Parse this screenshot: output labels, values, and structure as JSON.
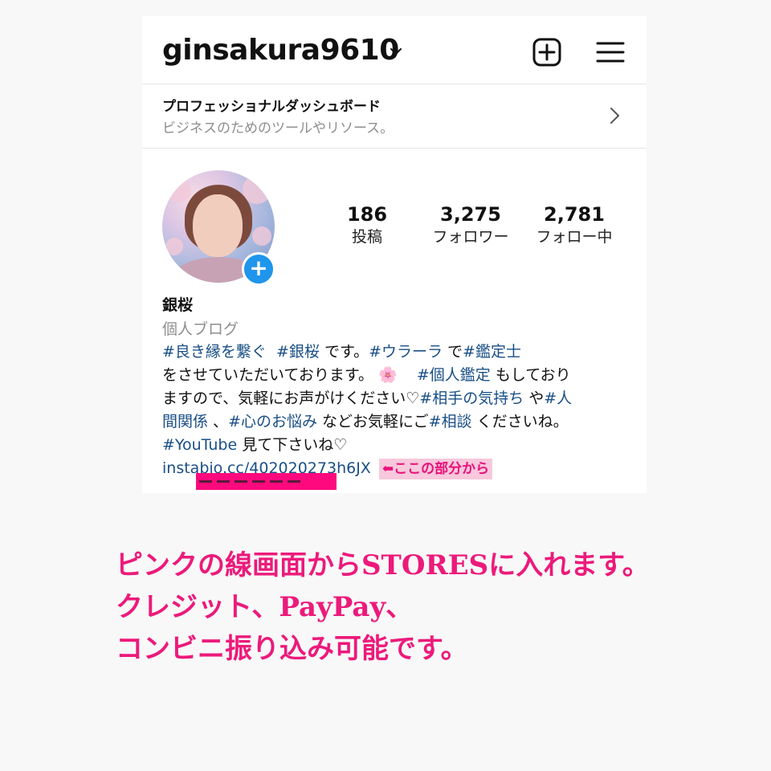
{
  "header": {
    "username": "ginsakura9610",
    "icons": [
      "chevron-down-icon",
      "plus-square-icon",
      "hamburger-menu-icon"
    ]
  },
  "dashboard": {
    "title": "プロフェッショナルダッシュボード",
    "subtitle": "ビジネスのためのツールやリソース。",
    "icon": "chevron-right-icon"
  },
  "profile": {
    "avatar_badge": "+",
    "stats": [
      {
        "value": "186",
        "label": "投稿"
      },
      {
        "value": "3,275",
        "label": "フォロワー"
      },
      {
        "value": "2,781",
        "label": "フォロー中"
      }
    ],
    "name": "銀桜",
    "category": "個人ブログ"
  },
  "bio": {
    "line1": {
      "t1": "#良き縁を繋ぐ",
      "t2": "#銀桜",
      "p1": " です。",
      "t3": "#ウラーラ",
      "p2": " で",
      "t4": "#鑑定士"
    },
    "line2": {
      "p1": "をさせていただいております。",
      "emoji": "🌸",
      "t1": "#個人鑑定",
      "p2": " もしており"
    },
    "line3": {
      "p1": "ますので、気軽にお声がけください♡",
      "t1": "#相手の気持ち",
      "p2": " や",
      "t2": "#人"
    },
    "line4": {
      "t1": "間関係",
      "p1": " 、",
      "t2": "#心のお悩み",
      "p2": " などお気軽にご",
      "t3": "#相談",
      "p3": " くださいね。"
    },
    "line5": {
      "t1": "#YouTube",
      "p1": " 見て下さいね♡"
    },
    "link": "instabio.cc/402020273h6JX",
    "note": "⬅ここの部分から"
  },
  "caption": {
    "line1": "ピンクの線画面からSTORESに入れます。",
    "line2": "クレジット、PayPay、",
    "line3": "コンビニ振り込み可能です。"
  },
  "colors": {
    "hashtag": "#1a4f86",
    "accent_pink": "#ec1a7b",
    "badge_blue": "#1f95ec"
  }
}
